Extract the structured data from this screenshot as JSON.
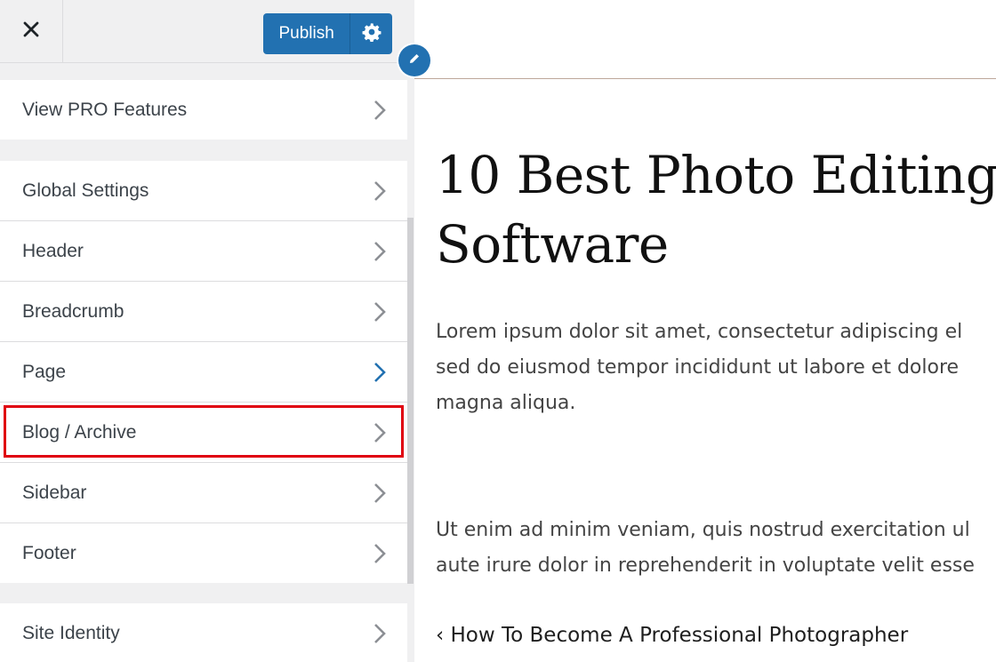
{
  "topbar": {
    "close_icon": "close-icon",
    "publish_label": "Publish",
    "settings_icon": "gear-icon",
    "accent_color": "#2271b1"
  },
  "sidebar": {
    "pro": [
      {
        "label": "View PRO Features"
      }
    ],
    "sections": [
      {
        "label": "Global Settings"
      },
      {
        "label": "Header"
      },
      {
        "label": "Breadcrumb"
      },
      {
        "label": "Page"
      },
      {
        "label": "Blog / Archive"
      },
      {
        "label": "Sidebar"
      },
      {
        "label": "Footer"
      }
    ],
    "identity": [
      {
        "label": "Site Identity"
      }
    ],
    "highlighted_item": "Blog / Archive",
    "highlight_color": "#e0000f"
  },
  "preview": {
    "title_line1": "10 Best Photo Editing",
    "title_line2": "Software",
    "p1_line1": "Lorem ipsum dolor sit amet, consectetur adipiscing el",
    "p1_line2": "sed do eiusmod tempor incididunt ut labore et dolore",
    "p1_line3": "magna aliqua.",
    "p2_line1": "Ut enim ad minim veniam, quis nostrud exercitation ul",
    "p2_line2": "aute irure dolor in reprehenderit in voluptate velit esse",
    "prev_post": "‹ How To Become A Professional Photographer",
    "edit_icon": "pencil-icon"
  }
}
